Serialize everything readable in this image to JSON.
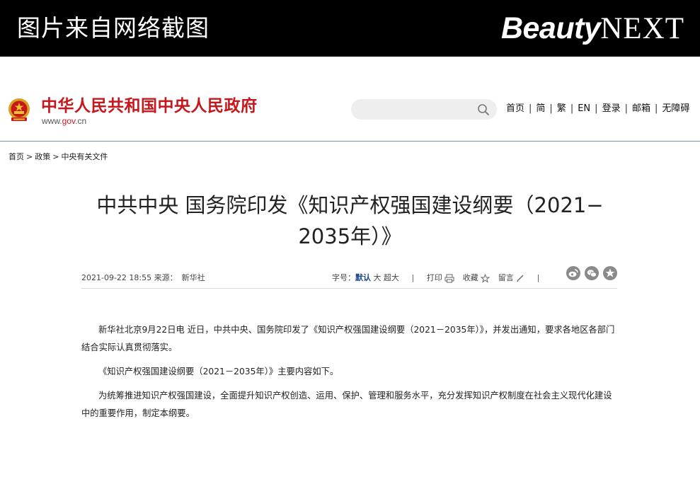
{
  "banner": {
    "caption": "图片来自网络截图",
    "brand_part1": "Beauty",
    "brand_part2": "NEXT"
  },
  "site": {
    "name": "中华人民共和国中央人民政府",
    "url_prefix": "www.",
    "url_gov": "gov",
    "url_suffix": ".cn",
    "brand_color": "#c8161d"
  },
  "nav": {
    "items": [
      "首页",
      "简",
      "繁",
      "EN",
      "登录",
      "邮箱",
      "无障碍"
    ],
    "separator": "|"
  },
  "breadcrumb": {
    "items": [
      "首页",
      "政策",
      "中央有关文件"
    ],
    "separator": ">"
  },
  "article": {
    "title_line1": "中共中央 国务院印发《知识产权强国建设纲要（2021−",
    "title_line2": "2035年）》",
    "date": "2021-09-22 18:55",
    "source_label": "来源：",
    "source": "新华社",
    "font_size_label": "字号：",
    "font_default": "默认",
    "font_large": "大",
    "font_xlarge": "超大",
    "print_label": "打印",
    "favorite_label": "收藏",
    "comment_label": "留言",
    "paragraphs": [
      "新华社北京9月22日电 近日，中共中央、国务院印发了《知识产权强国建设纲要（2021－2035年）》，并发出通知，要求各地区各部门结合实际认真贯彻落实。",
      "《知识产权强国建设纲要（2021－2035年）》主要内容如下。",
      "为统筹推进知识产权强国建设，全面提升知识产权创造、运用、保护、管理和服务水平，充分发挥知识产权制度在社会主义现代化建设中的重要作用，制定本纲要。"
    ]
  },
  "share": {
    "icons": [
      "weibo-icon",
      "wechat-icon",
      "qzone-icon"
    ]
  }
}
